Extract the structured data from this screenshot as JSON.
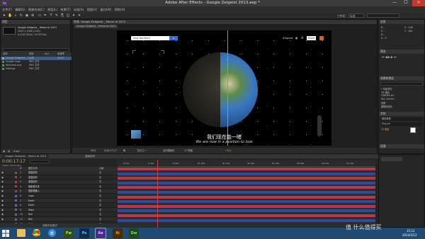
{
  "window": {
    "title": "Adobe After Effects - Google Zeigeist 2013.aep *",
    "minimize": "—",
    "maximize": "☐",
    "close": "✕"
  },
  "menu": [
    "文件(F)",
    "编辑(E)",
    "图像合成(C)",
    "图层(L)",
    "效果(T)",
    "动画(A)",
    "视图(V)",
    "窗口(W)",
    "帮助(H)"
  ],
  "toolbar": {
    "workspace_label": "工作区：",
    "workspace_value": "标准",
    "search_placeholder": "搜索帮助"
  },
  "project": {
    "tab": "项目",
    "comp_name": "Google Zeitgeist _ Meme to 2013",
    "comp_info": "1920 x 1080 (1.00)",
    "comp_duration": "Δ 0:02:38:00, 29.970 fps",
    "columns": [
      "名称",
      "类型",
      "大小",
      "帧速率"
    ],
    "items": [
      {
        "name": "Google Zeitgeist _ Meme to 2013",
        "type": "合成",
        "size": "",
        "fps": "29.97"
      },
      {
        "name": "Google Logo",
        "type": "PNG 文件",
        "size": "",
        "fps": ""
      },
      {
        "name": "Welcome.png",
        "type": "PNG 文件",
        "size": "",
        "fps": ""
      },
      {
        "name": "Settings",
        "type": "PNG 文件",
        "size": "",
        "fps": ""
      }
    ],
    "footer": "8 bpc"
  },
  "composition": {
    "tab": "合成: Google Zeitgeist _ Meme to 2013",
    "breadcrumb": "Google Zeitgeist _ Meme to 2013",
    "search_text": "new frontiers",
    "top_links": [
      "#Signals",
      "▦",
      "⚙",
      "Share"
    ],
    "subtitle_cn": "我们现在能一睹",
    "subtitle_en": "We are now in a position to look",
    "zoom": "50%",
    "timecode": "0;00;17;17",
    "resolution": "四分之一",
    "view": "活动摄像机",
    "views_count": "1个视图",
    "exposure": "+0.0"
  },
  "info_panel": {
    "tab": "信息",
    "lines": [
      "R : ",
      "G : ",
      "B : ",
      "A : 0"
    ],
    "coords": "X : 436\nY : 480"
  },
  "right_panels": {
    "preview": "预览",
    "effects": "效果和预设",
    "effects_search": "",
    "effects_items": [
      "* 动画预设",
      "3D 通道",
      "CINEMA 4D",
      "Key Correct",
      "音频",
      "模糊和锐化"
    ],
    "character": "字符",
    "font": "微软雅黑",
    "font_style": "Regular",
    "font_size": "70 像素",
    "paragraph": "段落"
  },
  "timeline": {
    "tab": "Google Zeitgeist _ Meme to 2013",
    "render_tab": "渲染队列",
    "timecode": "0:00:17:17",
    "frame": "00527 (29.97 fps)",
    "search_placeholder": "",
    "col_headers": [
      "#",
      "图层名称",
      "父级"
    ],
    "layers": [
      {
        "num": "1",
        "name": "英语副句"
      },
      {
        "num": "2",
        "name": "英语副句"
      },
      {
        "num": "3",
        "name": "英语副句"
      },
      {
        "num": "4",
        "name": "搜索框文本"
      },
      {
        "num": "5",
        "name": "搜索框输入"
      },
      {
        "num": "6",
        "name": "Logo"
      },
      {
        "num": "7",
        "name": "Earth"
      },
      {
        "num": "8",
        "name": "Earth"
      },
      {
        "num": "9",
        "name": "Stars"
      },
      {
        "num": "10",
        "name": "Null"
      },
      {
        "num": "11",
        "name": "Null"
      },
      {
        "num": "12",
        "name": "Null"
      }
    ],
    "parent_value": "无",
    "ruler": [
      "0:15s",
      "0:30s",
      "0:45s",
      "01:00s",
      "01:15s",
      "01:30s",
      "01:45s",
      "02:00s",
      "02:15s",
      "02:30s"
    ],
    "footer": "切换开关/模式"
  },
  "taskbar": {
    "apps": [
      "Fw",
      "Ps",
      "Ae",
      "Ai",
      "Dw"
    ],
    "time": "15:12",
    "date": "2014/2/12",
    "watermark": "值 什么值得买"
  },
  "colors": {
    "ae_purple": "#4a2a8a",
    "ps_blue": "#0c2a4c",
    "fw_green": "#2f4c1a",
    "ai_orange": "#4a2a00",
    "dw_green": "#1e4a1a",
    "track_red": "#b23a4a",
    "track_blue": "#2e4a9a"
  }
}
